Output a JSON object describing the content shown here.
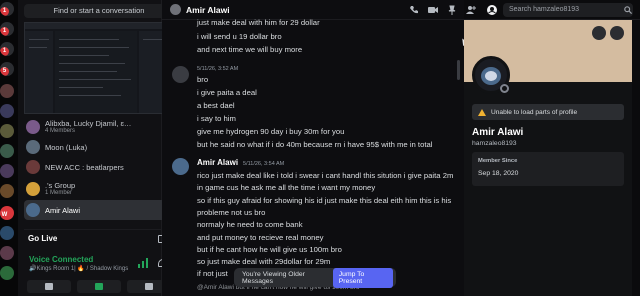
{
  "rail": {
    "badges": [
      "1",
      "1",
      "1",
      "5",
      "",
      "",
      "",
      "",
      "",
      "",
      "",
      "",
      "W",
      "",
      "",
      "W"
    ]
  },
  "sidebar": {
    "search_label": "Find or start a conversation",
    "dms": [
      {
        "name": "Alibxba, Lucky Djamil, ɛ…",
        "sub": "4 Members"
      },
      {
        "name": "Moon (Luka)",
        "sub": ""
      },
      {
        "name": "NEW ACC : beatlarpers",
        "sub": ""
      },
      {
        "name": ".'s Group",
        "sub": "1 Member"
      },
      {
        "name": "Amir Alawi",
        "sub": ""
      }
    ],
    "go_live": "Go Live",
    "voice_status": "Voice Connected",
    "voice_channel": "🔊Kings Room 1| 🔥 / Shadow Kings"
  },
  "topbar": {
    "name": "Amir Alawi",
    "search_placeholder": "Search hamzaleo8193"
  },
  "messages": {
    "lines_top": [
      "just make deal with him for 29 dollar",
      "i will send u 19 dollar bro",
      "and next time we will buy more"
    ],
    "ts1": "5/11/26, 3:52 AM",
    "block2": [
      "bro",
      "i give paita a deal",
      "a best dael",
      "i say to him",
      "give me hydrogen 90 day i buy 30m for you",
      "but he said no what if i do 40m because rn i have 95$ with me in total"
    ],
    "author": "Amir Alawi",
    "time": "5/11/26, 3:54 AM",
    "block3": [
      "rico just make deal like i told i swear i cant handl this sitution i give paita 2m",
      "in game cus he ask me all the time i want my money",
      "so if this guy afraid for showing his id just make this deal eith him this is his",
      "probleme not us bro",
      "normaly he need to come bank",
      "and put money to recieve real money",
      "but if he cant how he will give us 100m bro",
      "so just  make deal with 29dollar for 29m",
      "if not just"
    ],
    "older_label": "You're Viewing Older Messages",
    "jump_label": "Jump To Present",
    "reply_preview": "@Amir Alawi but if he can't how he will give us 100m bro"
  },
  "profile": {
    "warning": "Unable to load parts of profile",
    "name": "Amir Alawi",
    "username": "hamzaleo8193",
    "member_since_label": "Member Since",
    "member_since": "Sep 18, 2020"
  },
  "colors": {
    "accent": "#5865f2",
    "online": "#23a55a",
    "warning": "#f0b232",
    "badge": "#da373c"
  }
}
